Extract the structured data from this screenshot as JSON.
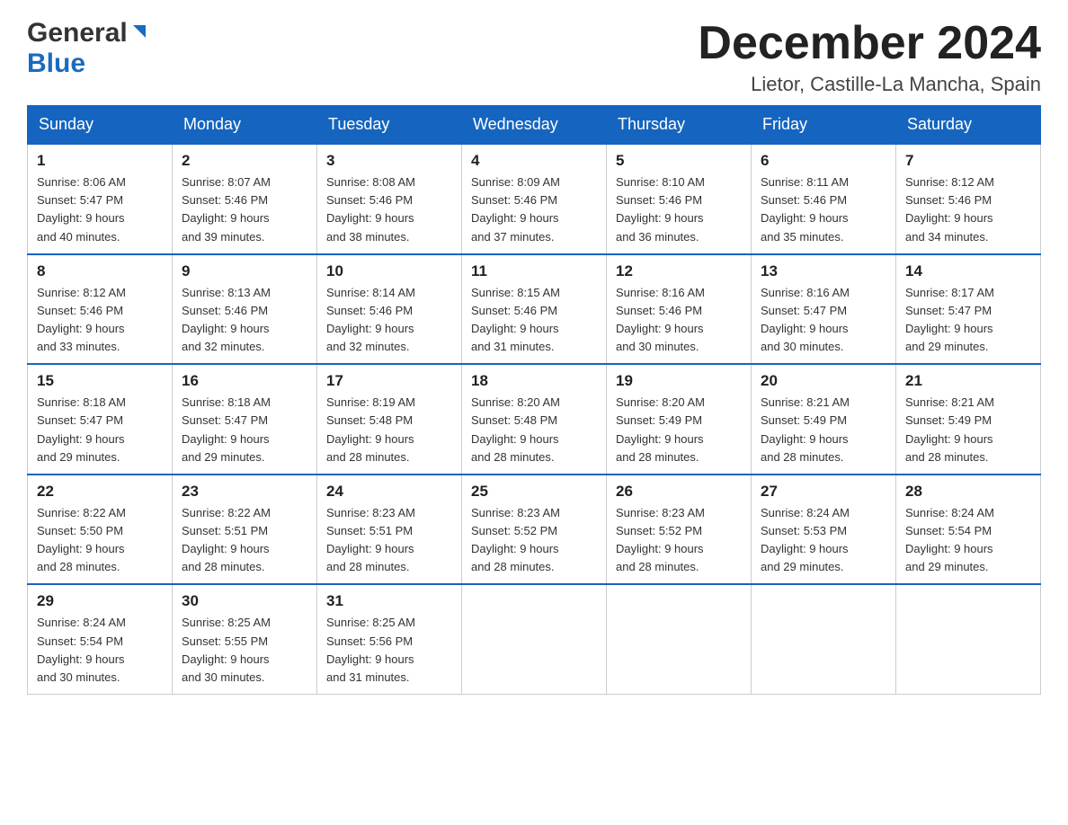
{
  "header": {
    "logo_general": "General",
    "logo_blue": "Blue",
    "month_title": "December 2024",
    "location": "Lietor, Castille-La Mancha, Spain"
  },
  "weekdays": [
    "Sunday",
    "Monday",
    "Tuesday",
    "Wednesday",
    "Thursday",
    "Friday",
    "Saturday"
  ],
  "weeks": [
    [
      {
        "day": "1",
        "sunrise": "8:06 AM",
        "sunset": "5:47 PM",
        "daylight": "9 hours and 40 minutes."
      },
      {
        "day": "2",
        "sunrise": "8:07 AM",
        "sunset": "5:46 PM",
        "daylight": "9 hours and 39 minutes."
      },
      {
        "day": "3",
        "sunrise": "8:08 AM",
        "sunset": "5:46 PM",
        "daylight": "9 hours and 38 minutes."
      },
      {
        "day": "4",
        "sunrise": "8:09 AM",
        "sunset": "5:46 PM",
        "daylight": "9 hours and 37 minutes."
      },
      {
        "day": "5",
        "sunrise": "8:10 AM",
        "sunset": "5:46 PM",
        "daylight": "9 hours and 36 minutes."
      },
      {
        "day": "6",
        "sunrise": "8:11 AM",
        "sunset": "5:46 PM",
        "daylight": "9 hours and 35 minutes."
      },
      {
        "day": "7",
        "sunrise": "8:12 AM",
        "sunset": "5:46 PM",
        "daylight": "9 hours and 34 minutes."
      }
    ],
    [
      {
        "day": "8",
        "sunrise": "8:12 AM",
        "sunset": "5:46 PM",
        "daylight": "9 hours and 33 minutes."
      },
      {
        "day": "9",
        "sunrise": "8:13 AM",
        "sunset": "5:46 PM",
        "daylight": "9 hours and 32 minutes."
      },
      {
        "day": "10",
        "sunrise": "8:14 AM",
        "sunset": "5:46 PM",
        "daylight": "9 hours and 32 minutes."
      },
      {
        "day": "11",
        "sunrise": "8:15 AM",
        "sunset": "5:46 PM",
        "daylight": "9 hours and 31 minutes."
      },
      {
        "day": "12",
        "sunrise": "8:16 AM",
        "sunset": "5:46 PM",
        "daylight": "9 hours and 30 minutes."
      },
      {
        "day": "13",
        "sunrise": "8:16 AM",
        "sunset": "5:47 PM",
        "daylight": "9 hours and 30 minutes."
      },
      {
        "day": "14",
        "sunrise": "8:17 AM",
        "sunset": "5:47 PM",
        "daylight": "9 hours and 29 minutes."
      }
    ],
    [
      {
        "day": "15",
        "sunrise": "8:18 AM",
        "sunset": "5:47 PM",
        "daylight": "9 hours and 29 minutes."
      },
      {
        "day": "16",
        "sunrise": "8:18 AM",
        "sunset": "5:47 PM",
        "daylight": "9 hours and 29 minutes."
      },
      {
        "day": "17",
        "sunrise": "8:19 AM",
        "sunset": "5:48 PM",
        "daylight": "9 hours and 28 minutes."
      },
      {
        "day": "18",
        "sunrise": "8:20 AM",
        "sunset": "5:48 PM",
        "daylight": "9 hours and 28 minutes."
      },
      {
        "day": "19",
        "sunrise": "8:20 AM",
        "sunset": "5:49 PM",
        "daylight": "9 hours and 28 minutes."
      },
      {
        "day": "20",
        "sunrise": "8:21 AM",
        "sunset": "5:49 PM",
        "daylight": "9 hours and 28 minutes."
      },
      {
        "day": "21",
        "sunrise": "8:21 AM",
        "sunset": "5:49 PM",
        "daylight": "9 hours and 28 minutes."
      }
    ],
    [
      {
        "day": "22",
        "sunrise": "8:22 AM",
        "sunset": "5:50 PM",
        "daylight": "9 hours and 28 minutes."
      },
      {
        "day": "23",
        "sunrise": "8:22 AM",
        "sunset": "5:51 PM",
        "daylight": "9 hours and 28 minutes."
      },
      {
        "day": "24",
        "sunrise": "8:23 AM",
        "sunset": "5:51 PM",
        "daylight": "9 hours and 28 minutes."
      },
      {
        "day": "25",
        "sunrise": "8:23 AM",
        "sunset": "5:52 PM",
        "daylight": "9 hours and 28 minutes."
      },
      {
        "day": "26",
        "sunrise": "8:23 AM",
        "sunset": "5:52 PM",
        "daylight": "9 hours and 28 minutes."
      },
      {
        "day": "27",
        "sunrise": "8:24 AM",
        "sunset": "5:53 PM",
        "daylight": "9 hours and 29 minutes."
      },
      {
        "day": "28",
        "sunrise": "8:24 AM",
        "sunset": "5:54 PM",
        "daylight": "9 hours and 29 minutes."
      }
    ],
    [
      {
        "day": "29",
        "sunrise": "8:24 AM",
        "sunset": "5:54 PM",
        "daylight": "9 hours and 30 minutes."
      },
      {
        "day": "30",
        "sunrise": "8:25 AM",
        "sunset": "5:55 PM",
        "daylight": "9 hours and 30 minutes."
      },
      {
        "day": "31",
        "sunrise": "8:25 AM",
        "sunset": "5:56 PM",
        "daylight": "9 hours and 31 minutes."
      },
      null,
      null,
      null,
      null
    ]
  ],
  "labels": {
    "sunrise": "Sunrise:",
    "sunset": "Sunset:",
    "daylight": "Daylight:"
  }
}
